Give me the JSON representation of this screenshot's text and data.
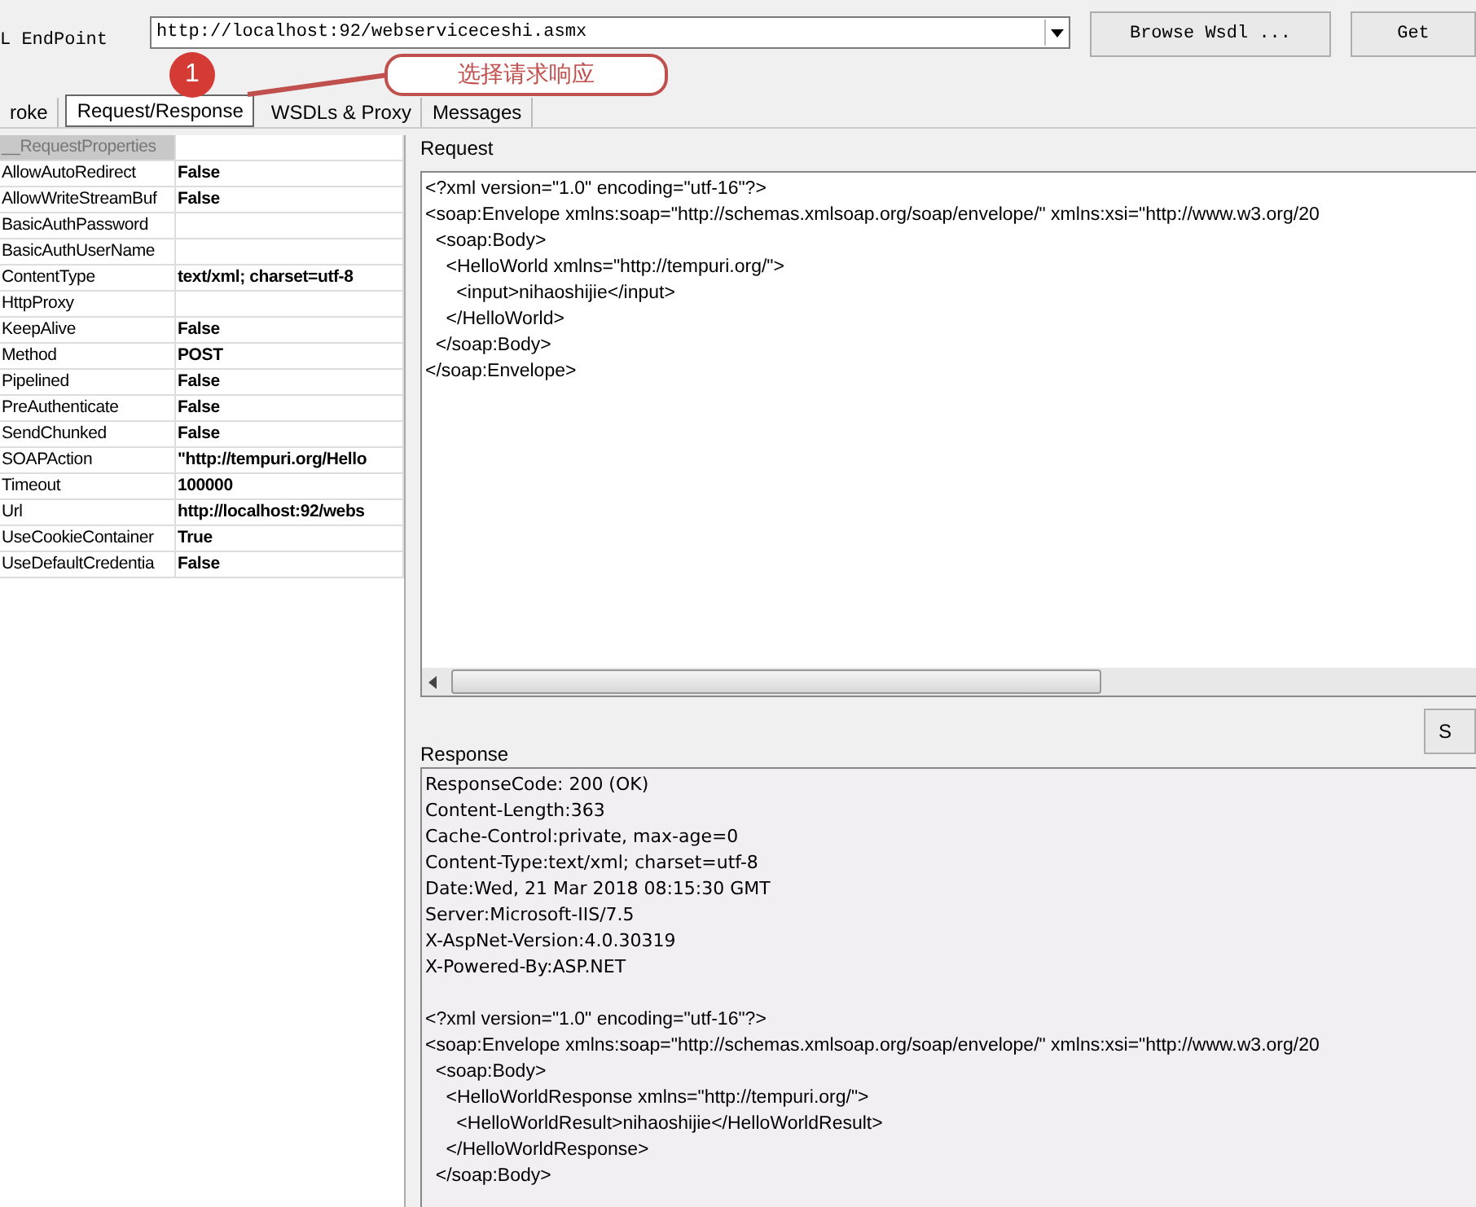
{
  "endpoint": {
    "label": "L EndPoint",
    "value": "http://localhost:92/webserviceceshi.asmx"
  },
  "buttons": [
    {
      "label": "Browse Wsdl ..."
    },
    {
      "label": "Get"
    }
  ],
  "tabs": [
    {
      "label": "roke",
      "selected": false
    },
    {
      "label": "Request/Response",
      "selected": true
    },
    {
      "label": "WSDLs & Proxy",
      "selected": false
    },
    {
      "label": "Messages",
      "selected": false
    }
  ],
  "properties": {
    "header": "__RequestProperties",
    "rows": [
      {
        "name": "AllowAutoRedirect",
        "value": "False"
      },
      {
        "name": "AllowWriteStreamBuf",
        "value": "False"
      },
      {
        "name": "BasicAuthPassword",
        "value": ""
      },
      {
        "name": "BasicAuthUserName",
        "value": ""
      },
      {
        "name": "ContentType",
        "value": "text/xml; charset=utf-8"
      },
      {
        "name": "HttpProxy",
        "value": ""
      },
      {
        "name": "KeepAlive",
        "value": "False"
      },
      {
        "name": "Method",
        "value": "POST"
      },
      {
        "name": "Pipelined",
        "value": "False"
      },
      {
        "name": "PreAuthenticate",
        "value": "False"
      },
      {
        "name": "SendChunked",
        "value": "False"
      },
      {
        "name": "SOAPAction",
        "value": "\"http://tempuri.org/Hello"
      },
      {
        "name": "Timeout",
        "value": "100000"
      },
      {
        "name": "Url",
        "value": "http://localhost:92/webs"
      },
      {
        "name": "UseCookieContainer",
        "value": "True"
      },
      {
        "name": "UseDefaultCredentia",
        "value": "False"
      }
    ]
  },
  "request": {
    "label": "Request",
    "lines": [
      "<?xml version=\"1.0\" encoding=\"utf-16\"?>",
      "<soap:Envelope xmlns:soap=\"http://schemas.xmlsoap.org/soap/envelope/\" xmlns:xsi=\"http://www.w3.org/20",
      "  <soap:Body>",
      "    <HelloWorld xmlns=\"http://tempuri.org/\">",
      "      <input>nihaoshijie</input>",
      "    </HelloWorld>",
      "  </soap:Body>",
      "</soap:Envelope>"
    ]
  },
  "send_button": {
    "label": "S"
  },
  "response": {
    "label": "Response",
    "headers": [
      "ResponseCode: 200 (OK)",
      "Content-Length:363",
      "Cache-Control:private, max-age=0",
      "Content-Type:text/xml; charset=utf-8",
      "Date:Wed, 21 Mar 2018 08:15:30 GMT",
      "Server:Microsoft-IIS/7.5",
      "X-AspNet-Version:4.0.30319",
      "X-Powered-By:ASP.NET"
    ],
    "lines": [
      "<?xml version=\"1.0\" encoding=\"utf-16\"?>",
      "<soap:Envelope xmlns:soap=\"http://schemas.xmlsoap.org/soap/envelope/\" xmlns:xsi=\"http://www.w3.org/20",
      "  <soap:Body>",
      "    <HelloWorldResponse xmlns=\"http://tempuri.org/\">",
      "      <HelloWorldResult>nihaoshijie</HelloWorldResult>",
      "    </HelloWorldResponse>",
      "  </soap:Body>"
    ]
  },
  "annotation": {
    "number": "1",
    "callout": "选择请求响应"
  }
}
